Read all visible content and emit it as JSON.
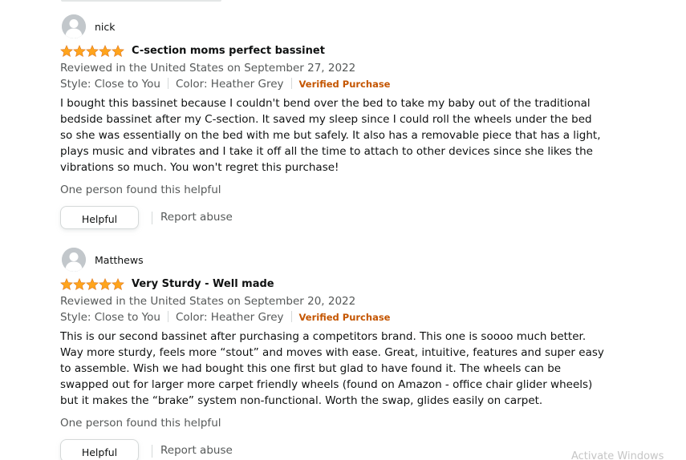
{
  "reviews": [
    {
      "profile_name": "nick",
      "rating": 5,
      "title": "C-section moms perfect bassinet",
      "meta": "Reviewed in the United States on September 27, 2022",
      "style": "Style: Close to You",
      "color": "Color: Heather Grey",
      "verified": "Verified Purchase",
      "body": "I bought this bassinet because I couldn't bend over the bed to take my baby out of the traditional bedside bassinet after my C-section. It saved my sleep since I could roll the wheels under the bed so she was essentially on the bed with me but safely. It also has a removable piece that has a light, plays music and vibrates and I take it off all the time to attach to other devices since she likes the vibrations so much. You won't regret this purchase!",
      "helpful_count_text": "One person found this helpful",
      "helpful_button": "Helpful",
      "report_link": "Report abuse"
    },
    {
      "profile_name": "Matthews",
      "rating": 5,
      "title": "Very Sturdy - Well made",
      "meta": "Reviewed in the United States on September 20, 2022",
      "style": "Style: Close to You",
      "color": "Color: Heather Grey",
      "verified": "Verified Purchase",
      "body": "This is our second bassinet after purchasing a competitors brand. This one is soooo much better. Way more sturdy, feels more “stout” and moves with ease. Great, intuitive, features and super easy to assemble. Wish we had bought this one first but glad to have found it. The wheels can be swapped out for larger more carpet friendly wheels (found on Amazon - office chair glider wheels) but it makes the “brake” system non-functional. Worth the swap, glides easily on carpet.",
      "helpful_count_text": "One person found this helpful",
      "helpful_button": "Helpful",
      "report_link": "Report abuse"
    }
  ],
  "watermark": "Activate Windows",
  "colors": {
    "star": "#ffa41c",
    "verified": "#c45500",
    "muted_text": "#565959"
  },
  "icons": {
    "avatar": "default-profile-avatar",
    "star": "filled-star"
  }
}
